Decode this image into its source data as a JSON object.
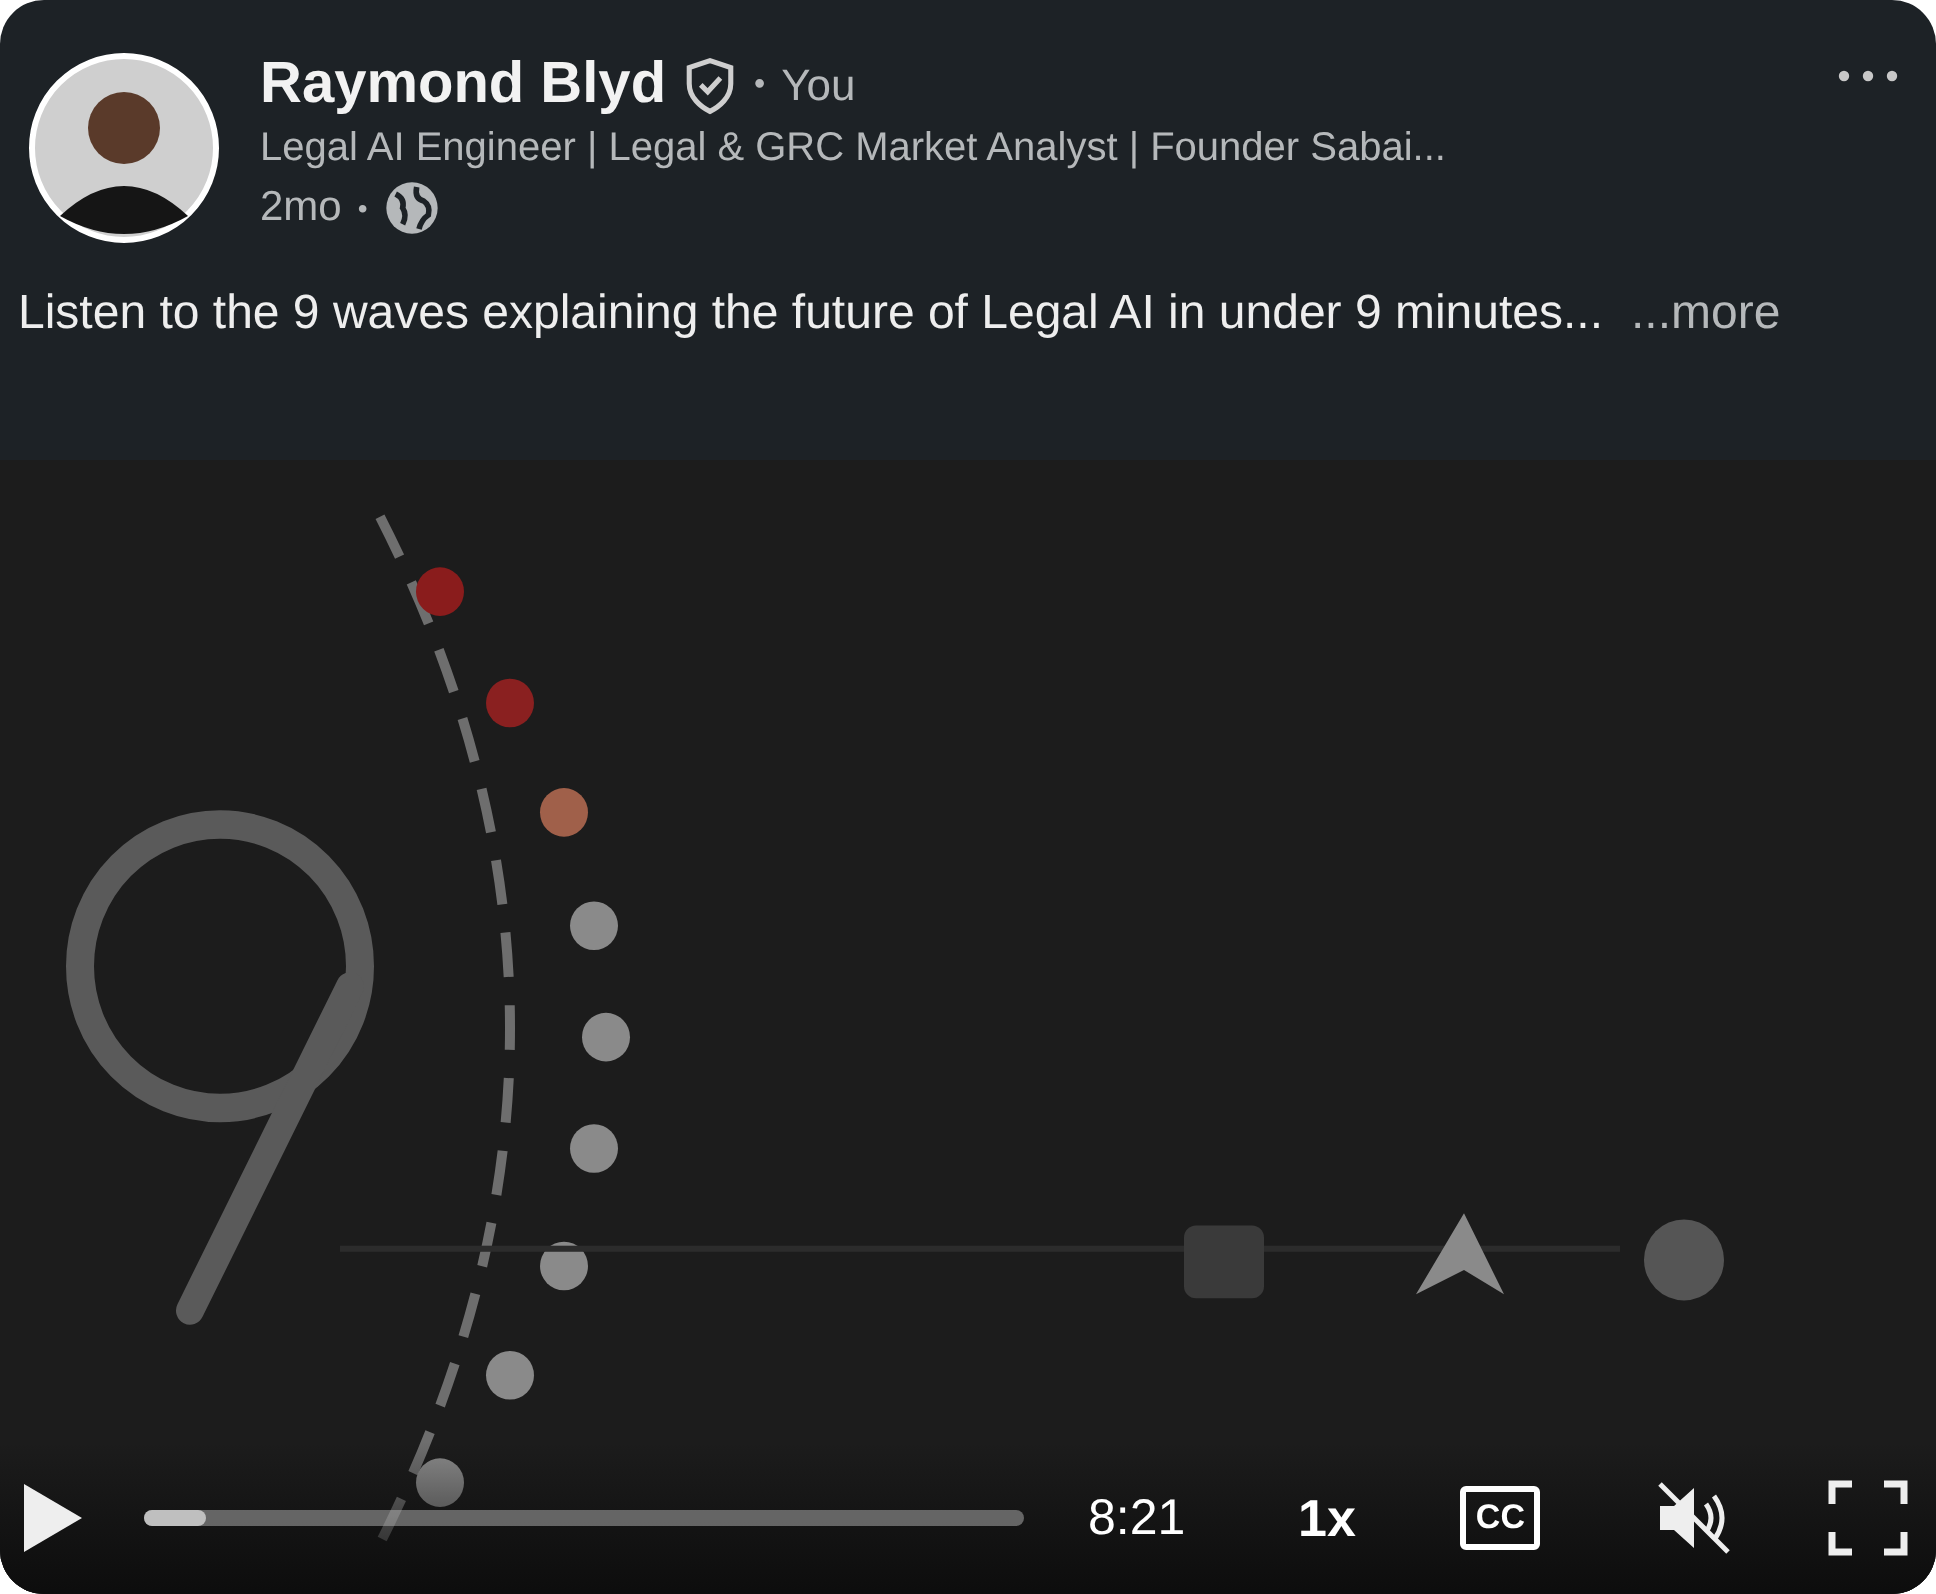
{
  "author": {
    "name": "Raymond Blyd",
    "verified": true,
    "name_separator": "•",
    "relation": "You",
    "headline": "Legal AI Engineer | Legal & GRC Market Analyst | Founder Sabai...",
    "time": "2mo",
    "time_separator": "•"
  },
  "post": {
    "text": "Listen to the 9 waves explaining the future of Legal AI in under 9 minutes...",
    "more": "...more"
  },
  "video": {
    "kind": "picture",
    "playing": false,
    "progress": {
      "level": 0.07
    },
    "duration": "8:21",
    "speed": "1x",
    "captions": "CC",
    "muted": true
  }
}
